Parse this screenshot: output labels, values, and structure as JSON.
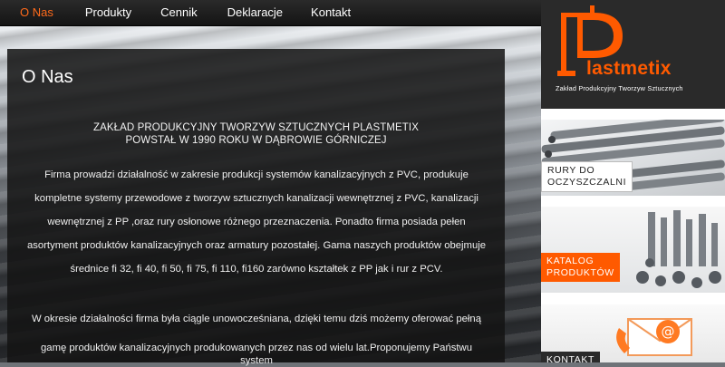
{
  "nav": {
    "items": [
      {
        "label": "O Nas",
        "active": true
      },
      {
        "label": "Produkty",
        "active": false
      },
      {
        "label": "Cennik",
        "active": false
      },
      {
        "label": "Deklaracje",
        "active": false
      },
      {
        "label": "Kontakt",
        "active": false
      }
    ]
  },
  "content": {
    "title": "O Nas",
    "lead_line1": "ZAKŁAD PRODUKCYJNY TWORZYW SZTUCZNYCH PLASTMETIX",
    "lead_line2": "POWSTAŁ W 1990 ROKU W DĄBROWIE GÓRNICZEJ",
    "para1": "Firma prowadzi działalność w zakresie produkcji systemów kanalizacyjnych z PVC,  produkuje kompletne systemy przewodowe  z tworzyw sztucznych kanalizacji wewnętrznej z PVC, kanalizacji wewnętrznej z PP ,oraz rury osłonowe różnego przeznaczenia. Ponadto firma posiada pełen asortyment produktów kanalizacyjnych oraz armatury pozostałej. Gama naszych produktów obejmuje średnice fi 32, fi 40, fi 50, fi 75, fi 110, fi160 zarówno kształtek z PP jak i rur z PCV.",
    "para2_line1": "W okresie działalności firma była ciągle unowocześniana, dzięki temu dziś możemy oferować pełną",
    "para2_line2": "gamę produktów kanalizacyjnych produkowanych przez nas od wielu lat.Proponujemy Państwu",
    "para2_line3": "system"
  },
  "sidebar": {
    "logo_word": "lastmetix",
    "logo_subtitle": "Zakład Produkcyjny Tworzyw Sztucznych",
    "tiles": [
      {
        "label_line1": "RURY DO",
        "label_line2": "OCZYSZCZALNI"
      },
      {
        "label_line1": "KATALOG",
        "label_line2": "PRODUKTÓW"
      },
      {
        "label_line1": "KONTAKT"
      }
    ]
  },
  "colors": {
    "accent": "#ff5a00",
    "panel": "#141414",
    "topbar": "#1c1c1c"
  }
}
